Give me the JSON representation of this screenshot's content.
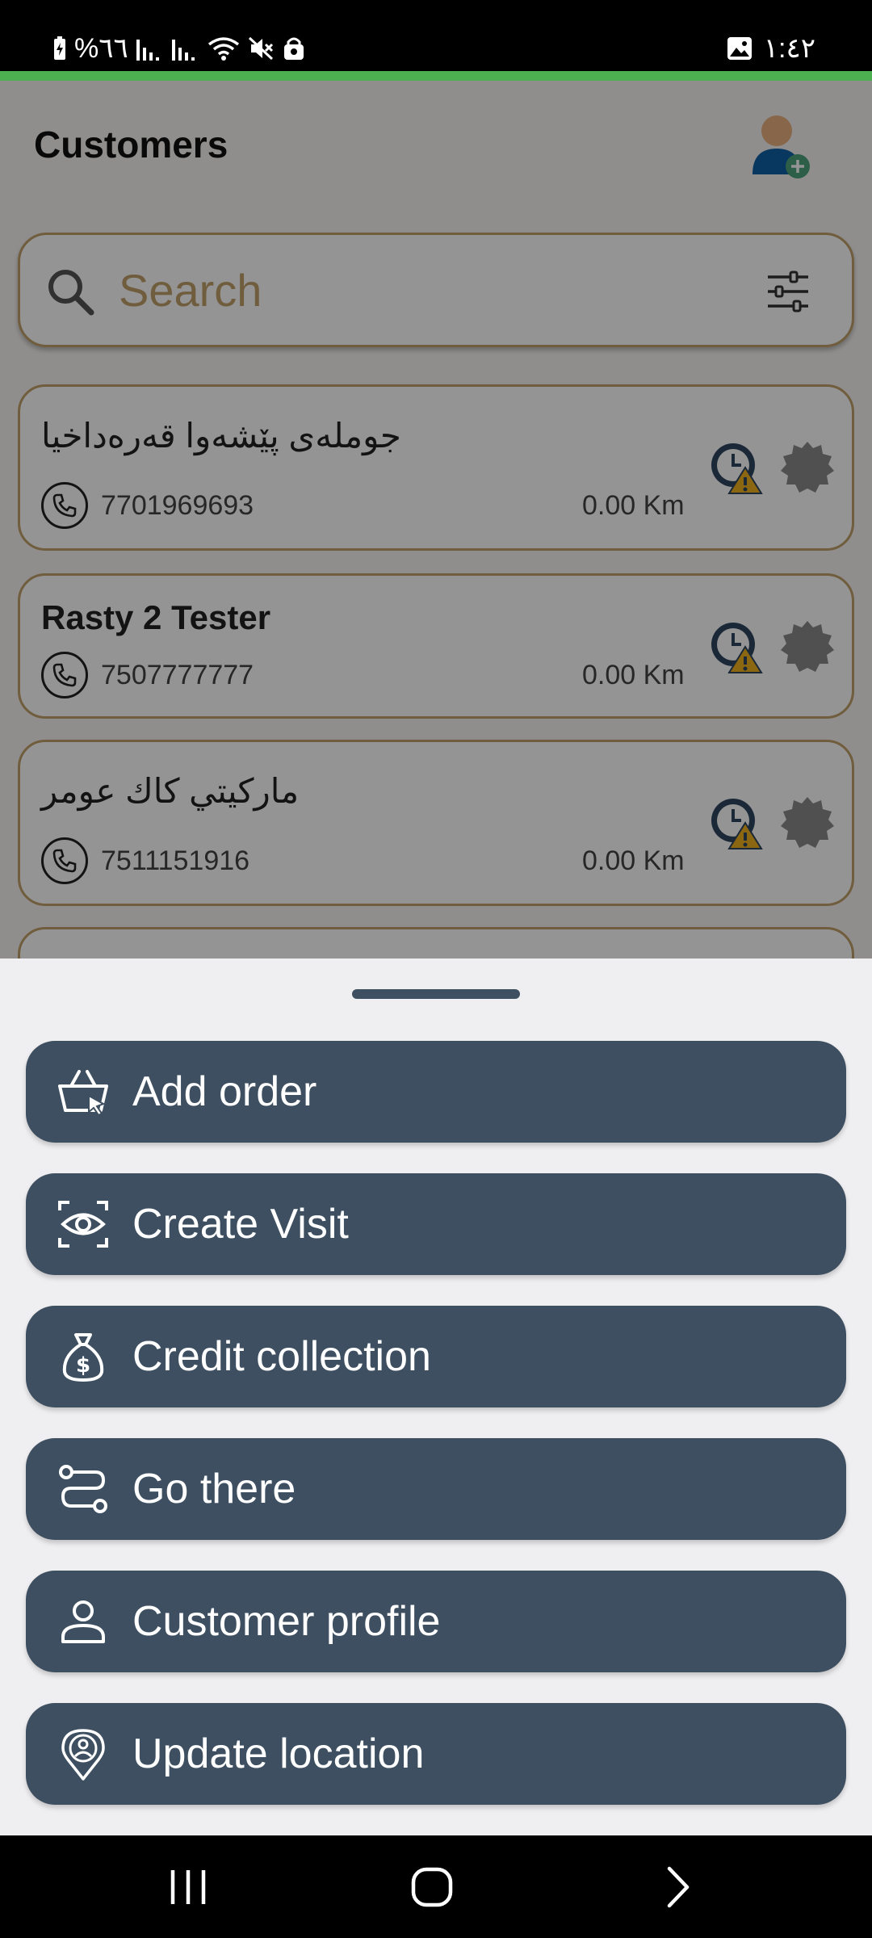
{
  "status_bar": {
    "battery_text": "%٦٦",
    "time": "١:٤٢",
    "icons": [
      "battery-icon",
      "signal-icon",
      "signal-icon",
      "wifi-icon",
      "mute-icon",
      "lock-icon",
      "image-icon"
    ]
  },
  "header": {
    "title": "Customers",
    "add_customer_icon": "add-user-icon"
  },
  "search": {
    "placeholder": "Search",
    "icon": "search-icon",
    "filter_icon": "sliders-icon"
  },
  "customers": [
    {
      "name": "جوملەی پێشەوا قەرەداخیا",
      "phone": "7701969693",
      "distance": "0.00 Km"
    },
    {
      "name": "Rasty 2 Tester",
      "phone": "7507777777",
      "distance": "0.00 Km"
    },
    {
      "name": "ماركيتي كاك عومر",
      "phone": "7511151916",
      "distance": "0.00 Km"
    }
  ],
  "actions": [
    {
      "label": "Add order",
      "icon": "basket-icon"
    },
    {
      "label": "Create Visit",
      "icon": "eye-scan-icon"
    },
    {
      "label": "Credit collection",
      "icon": "money-bag-icon"
    },
    {
      "label": "Go there",
      "icon": "route-icon"
    },
    {
      "label": "Customer profile",
      "icon": "person-icon"
    },
    {
      "label": "Update location",
      "icon": "location-pin-icon"
    }
  ],
  "colors": {
    "accent_green": "#4caf50",
    "button_bg": "#3d4f60",
    "card_border": "#c2a16a",
    "sheet_bg": "#efeff1"
  }
}
